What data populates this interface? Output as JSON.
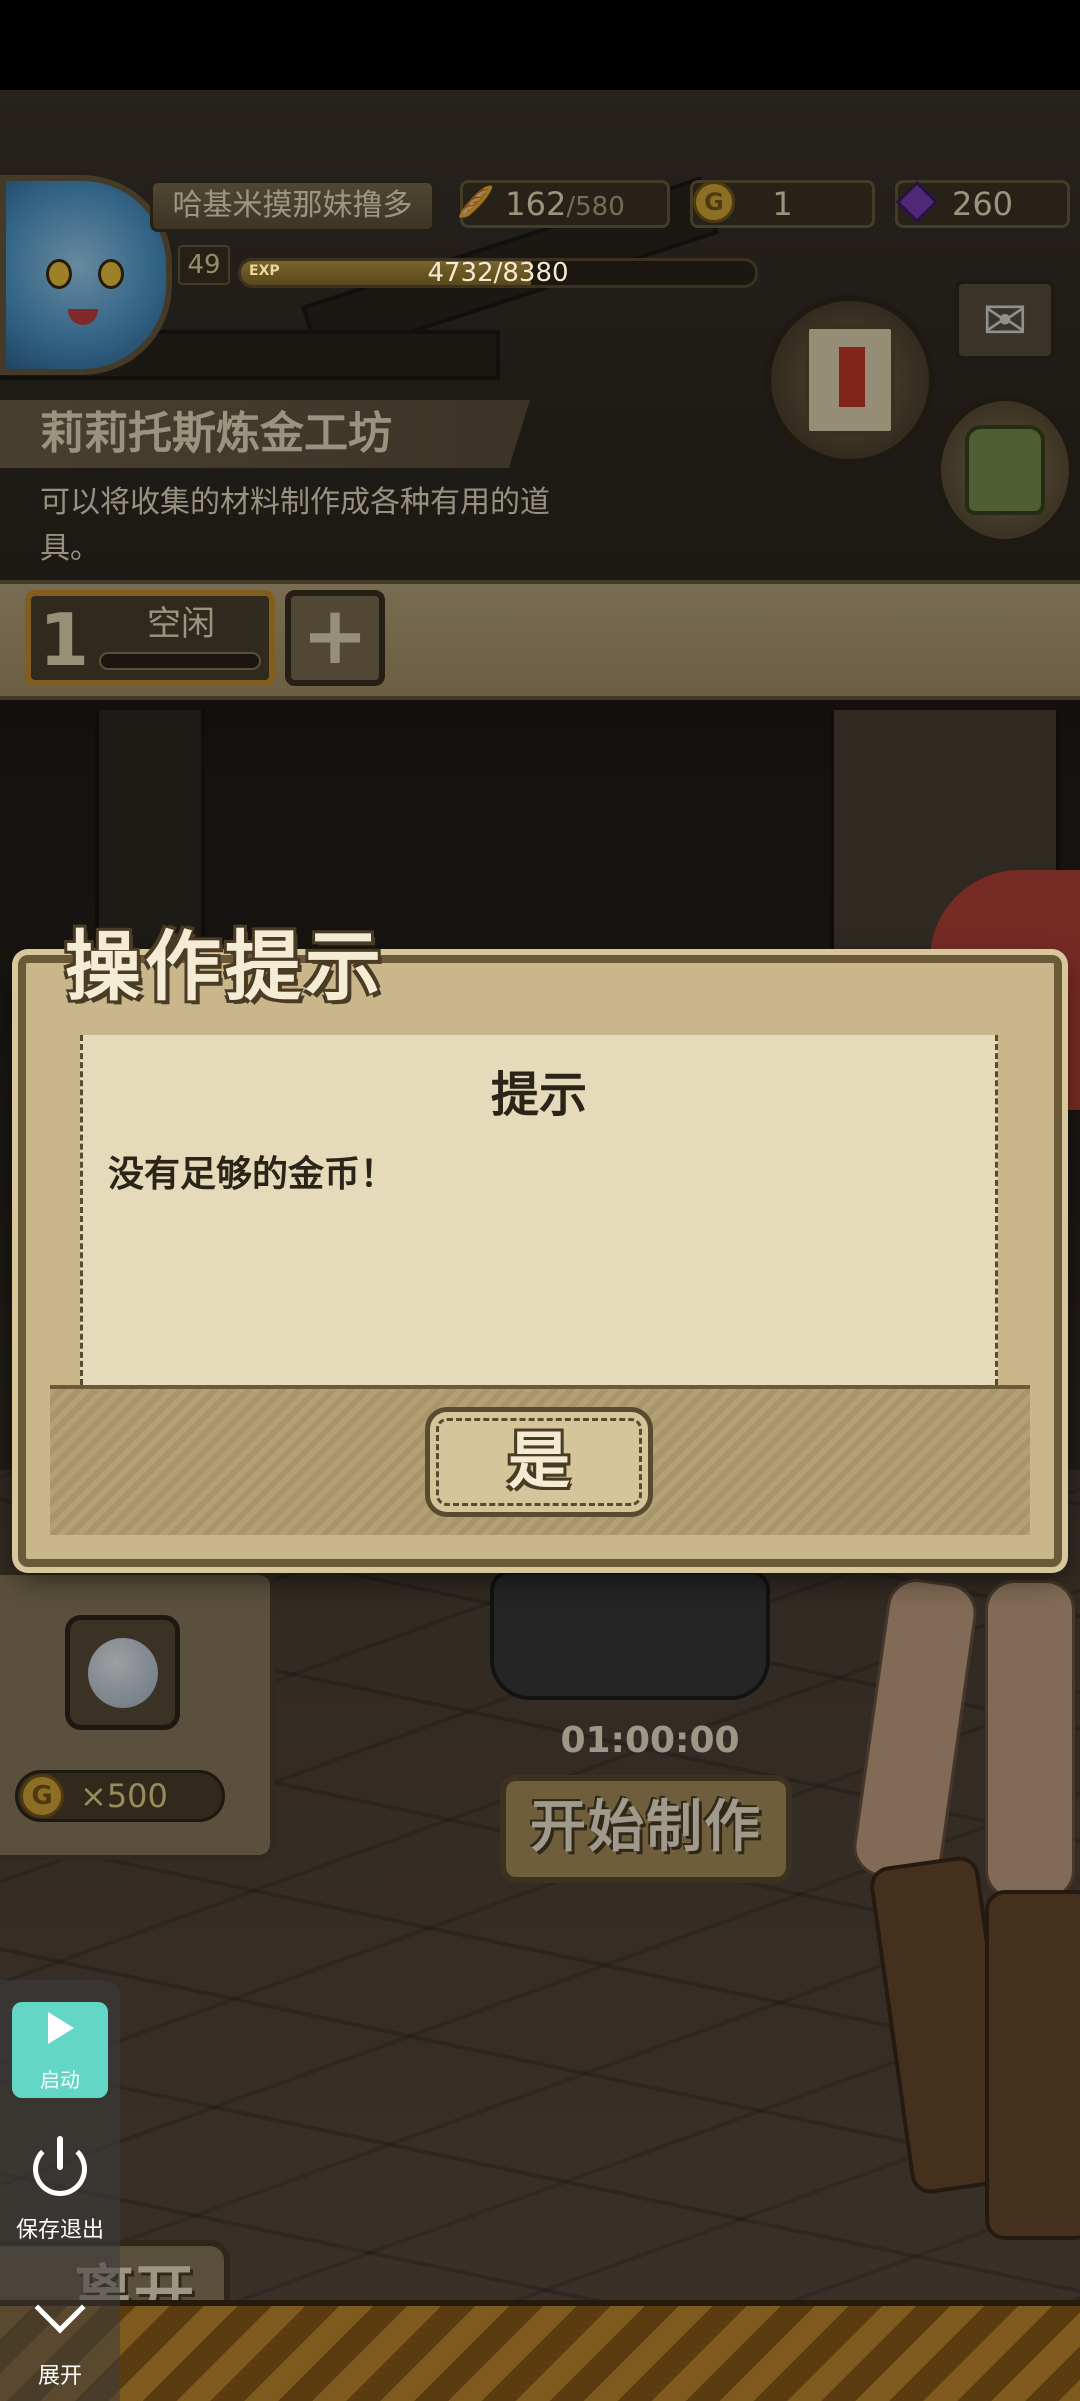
{
  "player": {
    "name": "哈基米摸那妹撸多",
    "level": "49",
    "exp_tag": "EXP",
    "exp_text": "4732/8380",
    "exp_current": 4732,
    "exp_max": 8380
  },
  "resources": {
    "stamina": "162",
    "stamina_max": "/580",
    "gold": "1",
    "gems": "260"
  },
  "workshop": {
    "title": "莉莉托斯炼金工坊",
    "description": "可以将收集的材料制作成各种有用的道具。"
  },
  "queue": {
    "slot_number": "1",
    "slot_status": "空闲",
    "add_symbol": "+"
  },
  "craft": {
    "cost": "×500",
    "coin_symbol": "G",
    "timer": "01:00:00",
    "start_label": "开始制作"
  },
  "leave_label": "离开",
  "dialog": {
    "title": "操作提示",
    "heading": "提示",
    "message": "没有足够的金币！",
    "confirm_label": "是"
  },
  "assistant": {
    "start_label": "启动",
    "save_exit_label": "保存退出",
    "expand_label": "展开"
  },
  "colors": {
    "accent_orange": "#c98f2f",
    "assistant_teal": "#63d6c7"
  }
}
